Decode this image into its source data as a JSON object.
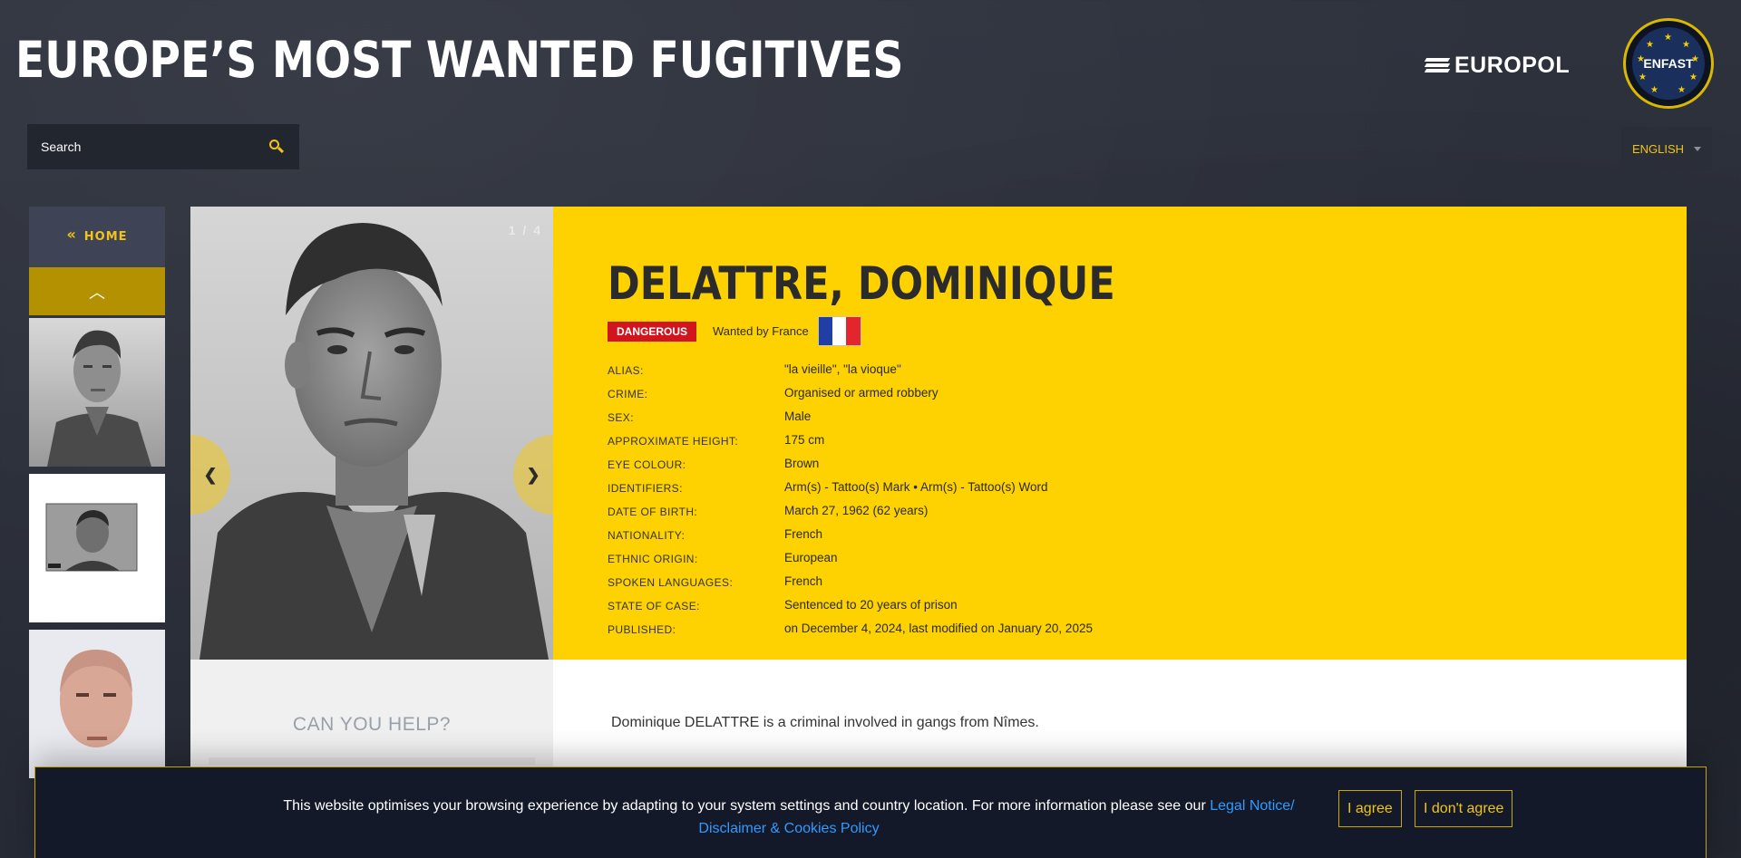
{
  "header": {
    "site_title": "EUROPE’S MOST WANTED FUGITIVES",
    "europol_label": "EUROPOL",
    "enfast_label": "ENFAST"
  },
  "search": {
    "placeholder": "Search"
  },
  "language": {
    "selected": "ENGLISH"
  },
  "sidebar": {
    "home_label": "HOME",
    "home_chevron": "«",
    "up_arrow": "︿"
  },
  "gallery": {
    "counter": "1 / 4",
    "prev": "❮",
    "next": "❯"
  },
  "profile": {
    "name": "DELATTRE, DOMINIQUE",
    "badge": "DANGEROUS",
    "wanted_by": "Wanted by France",
    "flag_colors": [
      "#1f3fa5",
      "#ffffff",
      "#e3262e"
    ],
    "details": [
      {
        "label": "ALIAS:",
        "value": "\"la vieille\", \"la vioque\""
      },
      {
        "label": "CRIME:",
        "value": "Organised or armed robbery"
      },
      {
        "label": "SEX:",
        "value": "Male"
      },
      {
        "label": "APPROXIMATE HEIGHT:",
        "value": "175 cm"
      },
      {
        "label": "EYE COLOUR:",
        "value": "Brown"
      },
      {
        "label": "IDENTIFIERS:",
        "value": "Arm(s) - Tattoo(s) Mark • Arm(s) - Tattoo(s) Word"
      },
      {
        "label": "DATE OF BIRTH:",
        "value": "March 27, 1962 (62 years)"
      },
      {
        "label": "NATIONALITY:",
        "value": "French"
      },
      {
        "label": "ETHNIC ORIGIN:",
        "value": "European"
      },
      {
        "label": "SPOKEN LANGUAGES:",
        "value": "French"
      },
      {
        "label": "STATE OF CASE:",
        "value": "Sentenced to 20 years of prison"
      },
      {
        "label": "PUBLISHED:",
        "value": "on December 4, 2024, last modified on January 20, 2025"
      }
    ],
    "description": "Dominique DELATTRE is a criminal involved in gangs from Nîmes."
  },
  "help": {
    "title": "CAN YOU HELP?"
  },
  "cookie": {
    "text": "This website optimises your browsing experience by adapting to your system settings and country location. For more information please see our ",
    "link_line1": "Legal Notice/",
    "link_line2": "Disclaimer & Cookies Policy",
    "agree": "I agree",
    "disagree": "I don't agree"
  },
  "colors": {
    "accent": "#fed100",
    "danger": "#d0151e",
    "link": "#2f9bff"
  }
}
